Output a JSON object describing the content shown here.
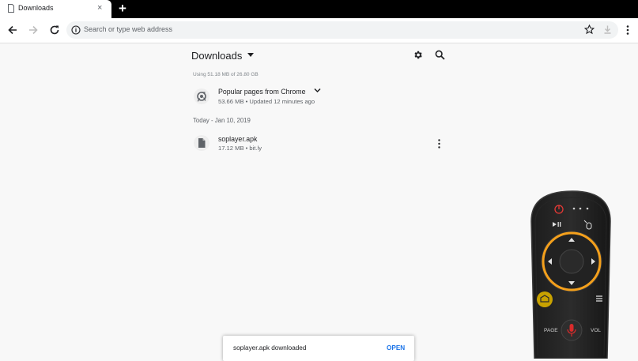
{
  "tab": {
    "title": "Downloads",
    "close": "×",
    "new_tab": "+"
  },
  "omnibox": {
    "placeholder": "Search or type web address"
  },
  "downloads": {
    "title": "Downloads",
    "storage_text": "Using 51.18 MB of 26.80 GB",
    "offline_group": {
      "title": "Popular pages from Chrome",
      "subtitle": "53.66 MB • Updated 12 minutes ago"
    },
    "date_header": "Today - Jan 10, 2019",
    "items": [
      {
        "name": "soplayer.apk",
        "meta": "17.12 MB • bit.ly"
      }
    ]
  },
  "snackbar": {
    "message": "soplayer.apk downloaded",
    "action": "OPEN"
  },
  "remote": {
    "page_label": "PAGE",
    "vol_label": "VOL"
  },
  "colors": {
    "accent_blue": "#1a73e8",
    "remote_ring": "#f4a01c",
    "remote_home": "#c8a200",
    "remote_mic": "#d92b2b"
  }
}
